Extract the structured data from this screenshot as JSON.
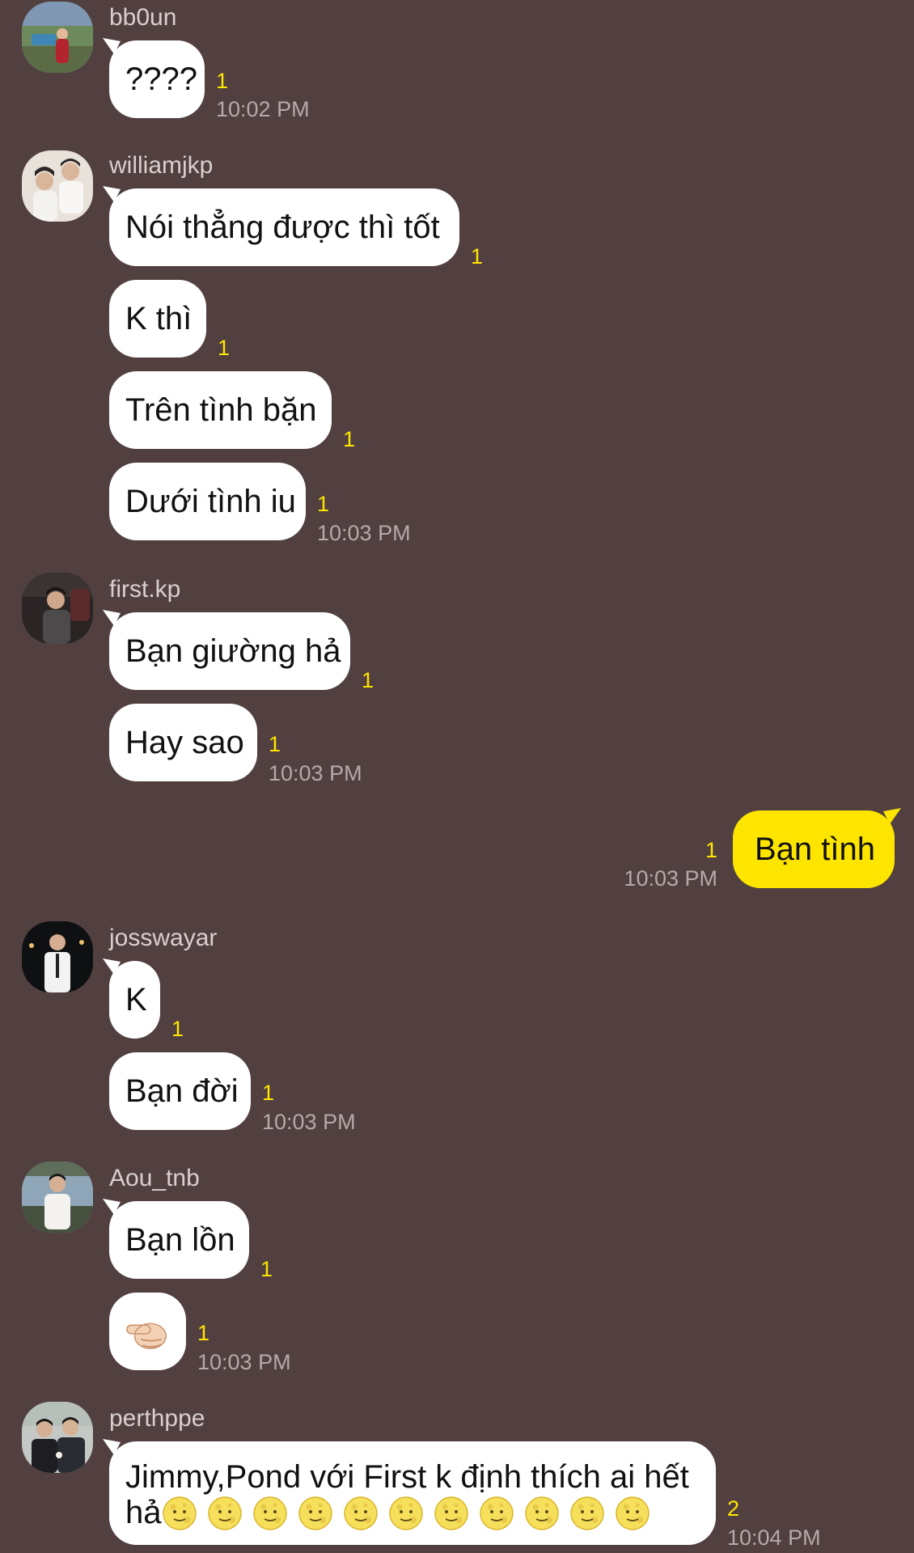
{
  "colors": {
    "background": "#524040",
    "bubble_incoming": "#ffffff",
    "bubble_outgoing": "#fee500",
    "unread_count": "#fee500",
    "timestamp": "#b5a9a9",
    "username": "#d9cfcf"
  },
  "messages": {
    "g1": {
      "user": "bb0un",
      "m1": {
        "text": "????",
        "unread": "1",
        "time": "10:02 PM"
      }
    },
    "g2": {
      "user": "williamjkp",
      "m1": {
        "text": "Nói thẳng được thì tốt",
        "unread": "1"
      },
      "m2": {
        "text": "K thì",
        "unread": "1"
      },
      "m3": {
        "text": "Trên tình bặn",
        "unread": "1"
      },
      "m4": {
        "text": "Dưới tình iu",
        "unread": "1",
        "time": "10:03 PM"
      }
    },
    "g3": {
      "user": "first.kp",
      "m1": {
        "text": "Bạn giường hả",
        "unread": "1"
      },
      "m2": {
        "text": "Hay sao",
        "unread": "1",
        "time": "10:03 PM"
      }
    },
    "mine": {
      "m1": {
        "text": "Bạn tình",
        "unread": "1",
        "time": "10:03 PM"
      }
    },
    "g4": {
      "user": "josswayar",
      "m1": {
        "text": "K",
        "unread": "1"
      },
      "m2": {
        "text": "Bạn đời",
        "unread": "1",
        "time": "10:03 PM"
      }
    },
    "g5": {
      "user": "Aou_tnb",
      "m1": {
        "text": "Bạn lồn",
        "unread": "1"
      },
      "m2": {
        "emoji": "pointing-finger-emoji",
        "unread": "1",
        "time": "10:03 PM"
      }
    },
    "g6": {
      "user": "perthppe",
      "m1": {
        "line1": "Jimmy,Pond với First k định thích ai hết",
        "line2": "hả",
        "emoji": "full-moon-face-emoji",
        "unread": "2",
        "time": "10:04 PM"
      }
    }
  }
}
